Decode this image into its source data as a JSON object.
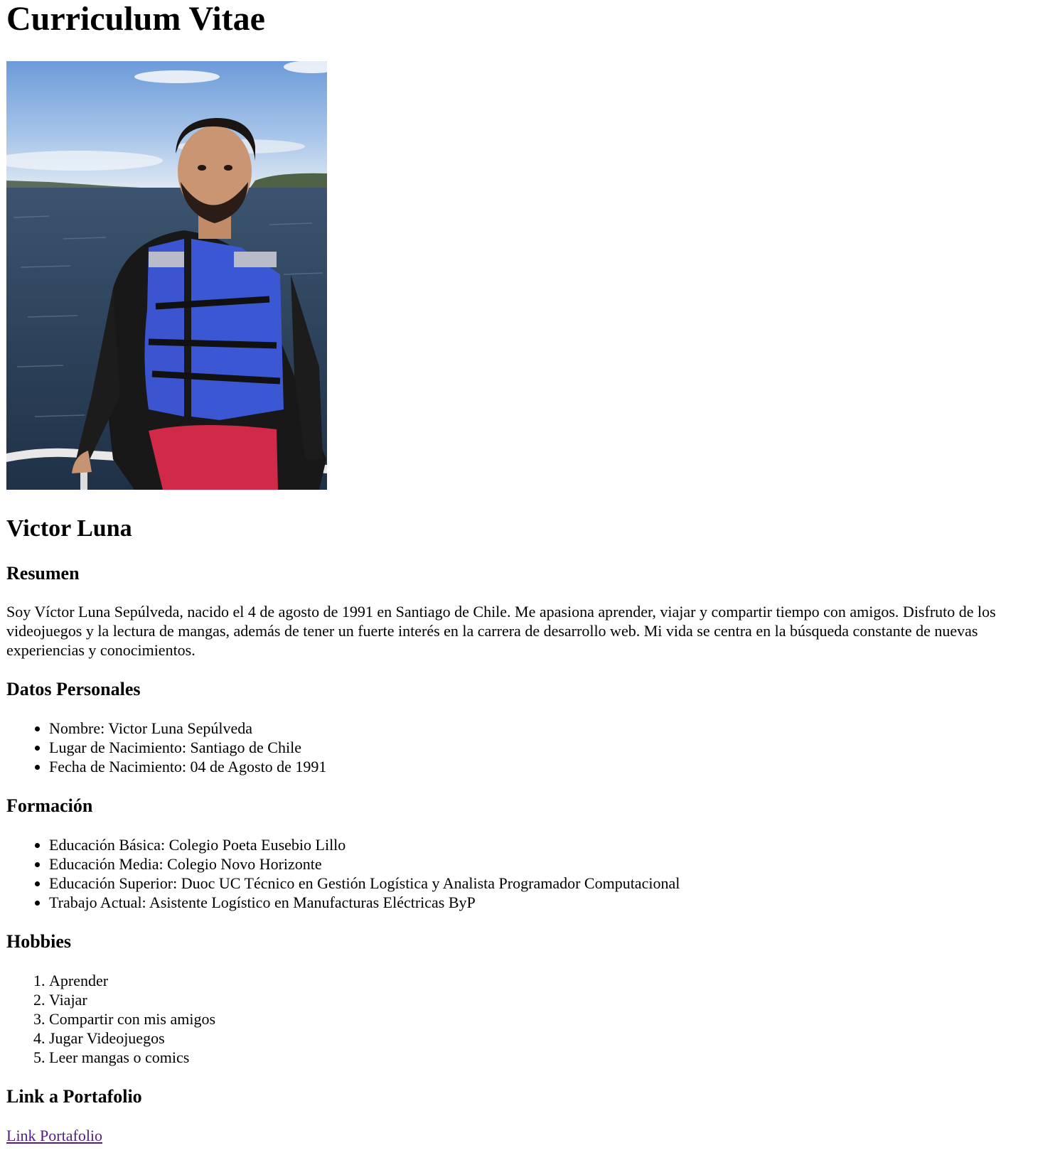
{
  "page_title": "Curriculum Vitae",
  "photo": {
    "alt": "Foto de Victor Luna"
  },
  "name": "Victor Luna",
  "summary": {
    "heading": "Resumen",
    "text": "Soy Víctor Luna Sepúlveda, nacido el 4 de agosto de 1991 en Santiago de Chile. Me apasiona aprender, viajar y compartir tiempo con amigos. Disfruto de los videojuegos y la lectura de mangas, además de tener un fuerte interés en la carrera de desarrollo web. Mi vida se centra en la búsqueda constante de nuevas experiencias y conocimientos."
  },
  "personal": {
    "heading": "Datos Personales",
    "items": [
      "Nombre: Victor Luna Sepúlveda",
      "Lugar de Nacimiento: Santiago de Chile",
      "Fecha de Nacimiento: 04 de Agosto de 1991"
    ]
  },
  "education": {
    "heading": "Formación",
    "items": [
      "Educación Básica: Colegio Poeta Eusebio Lillo",
      "Educación Media: Colegio Novo Horizonte",
      "Educación Superior: Duoc UC Técnico en Gestión Logística y Analista Programador Computacional",
      "Trabajo Actual: Asistente Logístico en Manufacturas Eléctricas ByP"
    ]
  },
  "hobbies": {
    "heading": "Hobbies",
    "items": [
      "Aprender",
      "Viajar",
      "Compartir con mis amigos",
      "Jugar Videojuegos",
      "Leer mangas o comics"
    ]
  },
  "portfolio": {
    "heading": "Link a Portafolio",
    "link_label": "Link Portafolio"
  },
  "colors": {
    "link_visited": "#551a8b",
    "text": "#000000"
  }
}
